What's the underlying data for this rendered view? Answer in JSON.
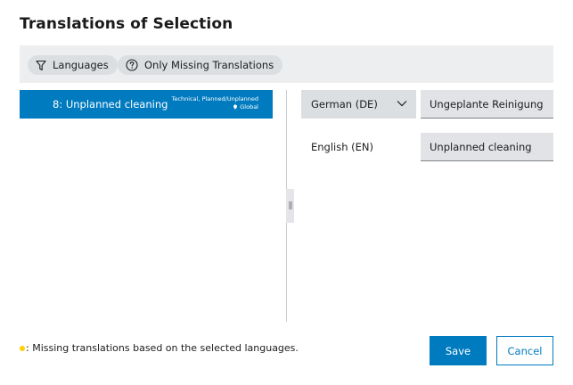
{
  "dialog": {
    "title": "Translations of Selection"
  },
  "filters": {
    "languages_label": "Languages",
    "only_missing_label": "Only Missing Translations"
  },
  "list": {
    "items": [
      {
        "label": "8: Unplanned cleaning",
        "meta_line1": "Technical, Planned/Unplanned",
        "meta_line2": "Global",
        "selected": true
      }
    ]
  },
  "translations": {
    "source_language": "German (DE)",
    "source_value": "Ungeplante Reinigung",
    "target_language": "English (EN)",
    "target_value": "Unplanned cleaning"
  },
  "legend": {
    "text": ": Missing translations based on the selected languages."
  },
  "buttons": {
    "save": "Save",
    "cancel": "Cancel"
  },
  "colors": {
    "primary": "#007bc0",
    "missing_dot": "#ffcf00"
  },
  "icons": {
    "languages_chip": "filter-icon",
    "only_missing_chip": "question-circle-icon",
    "language_dropdown": "chevron-down-icon",
    "meta_location": "location-icon"
  }
}
